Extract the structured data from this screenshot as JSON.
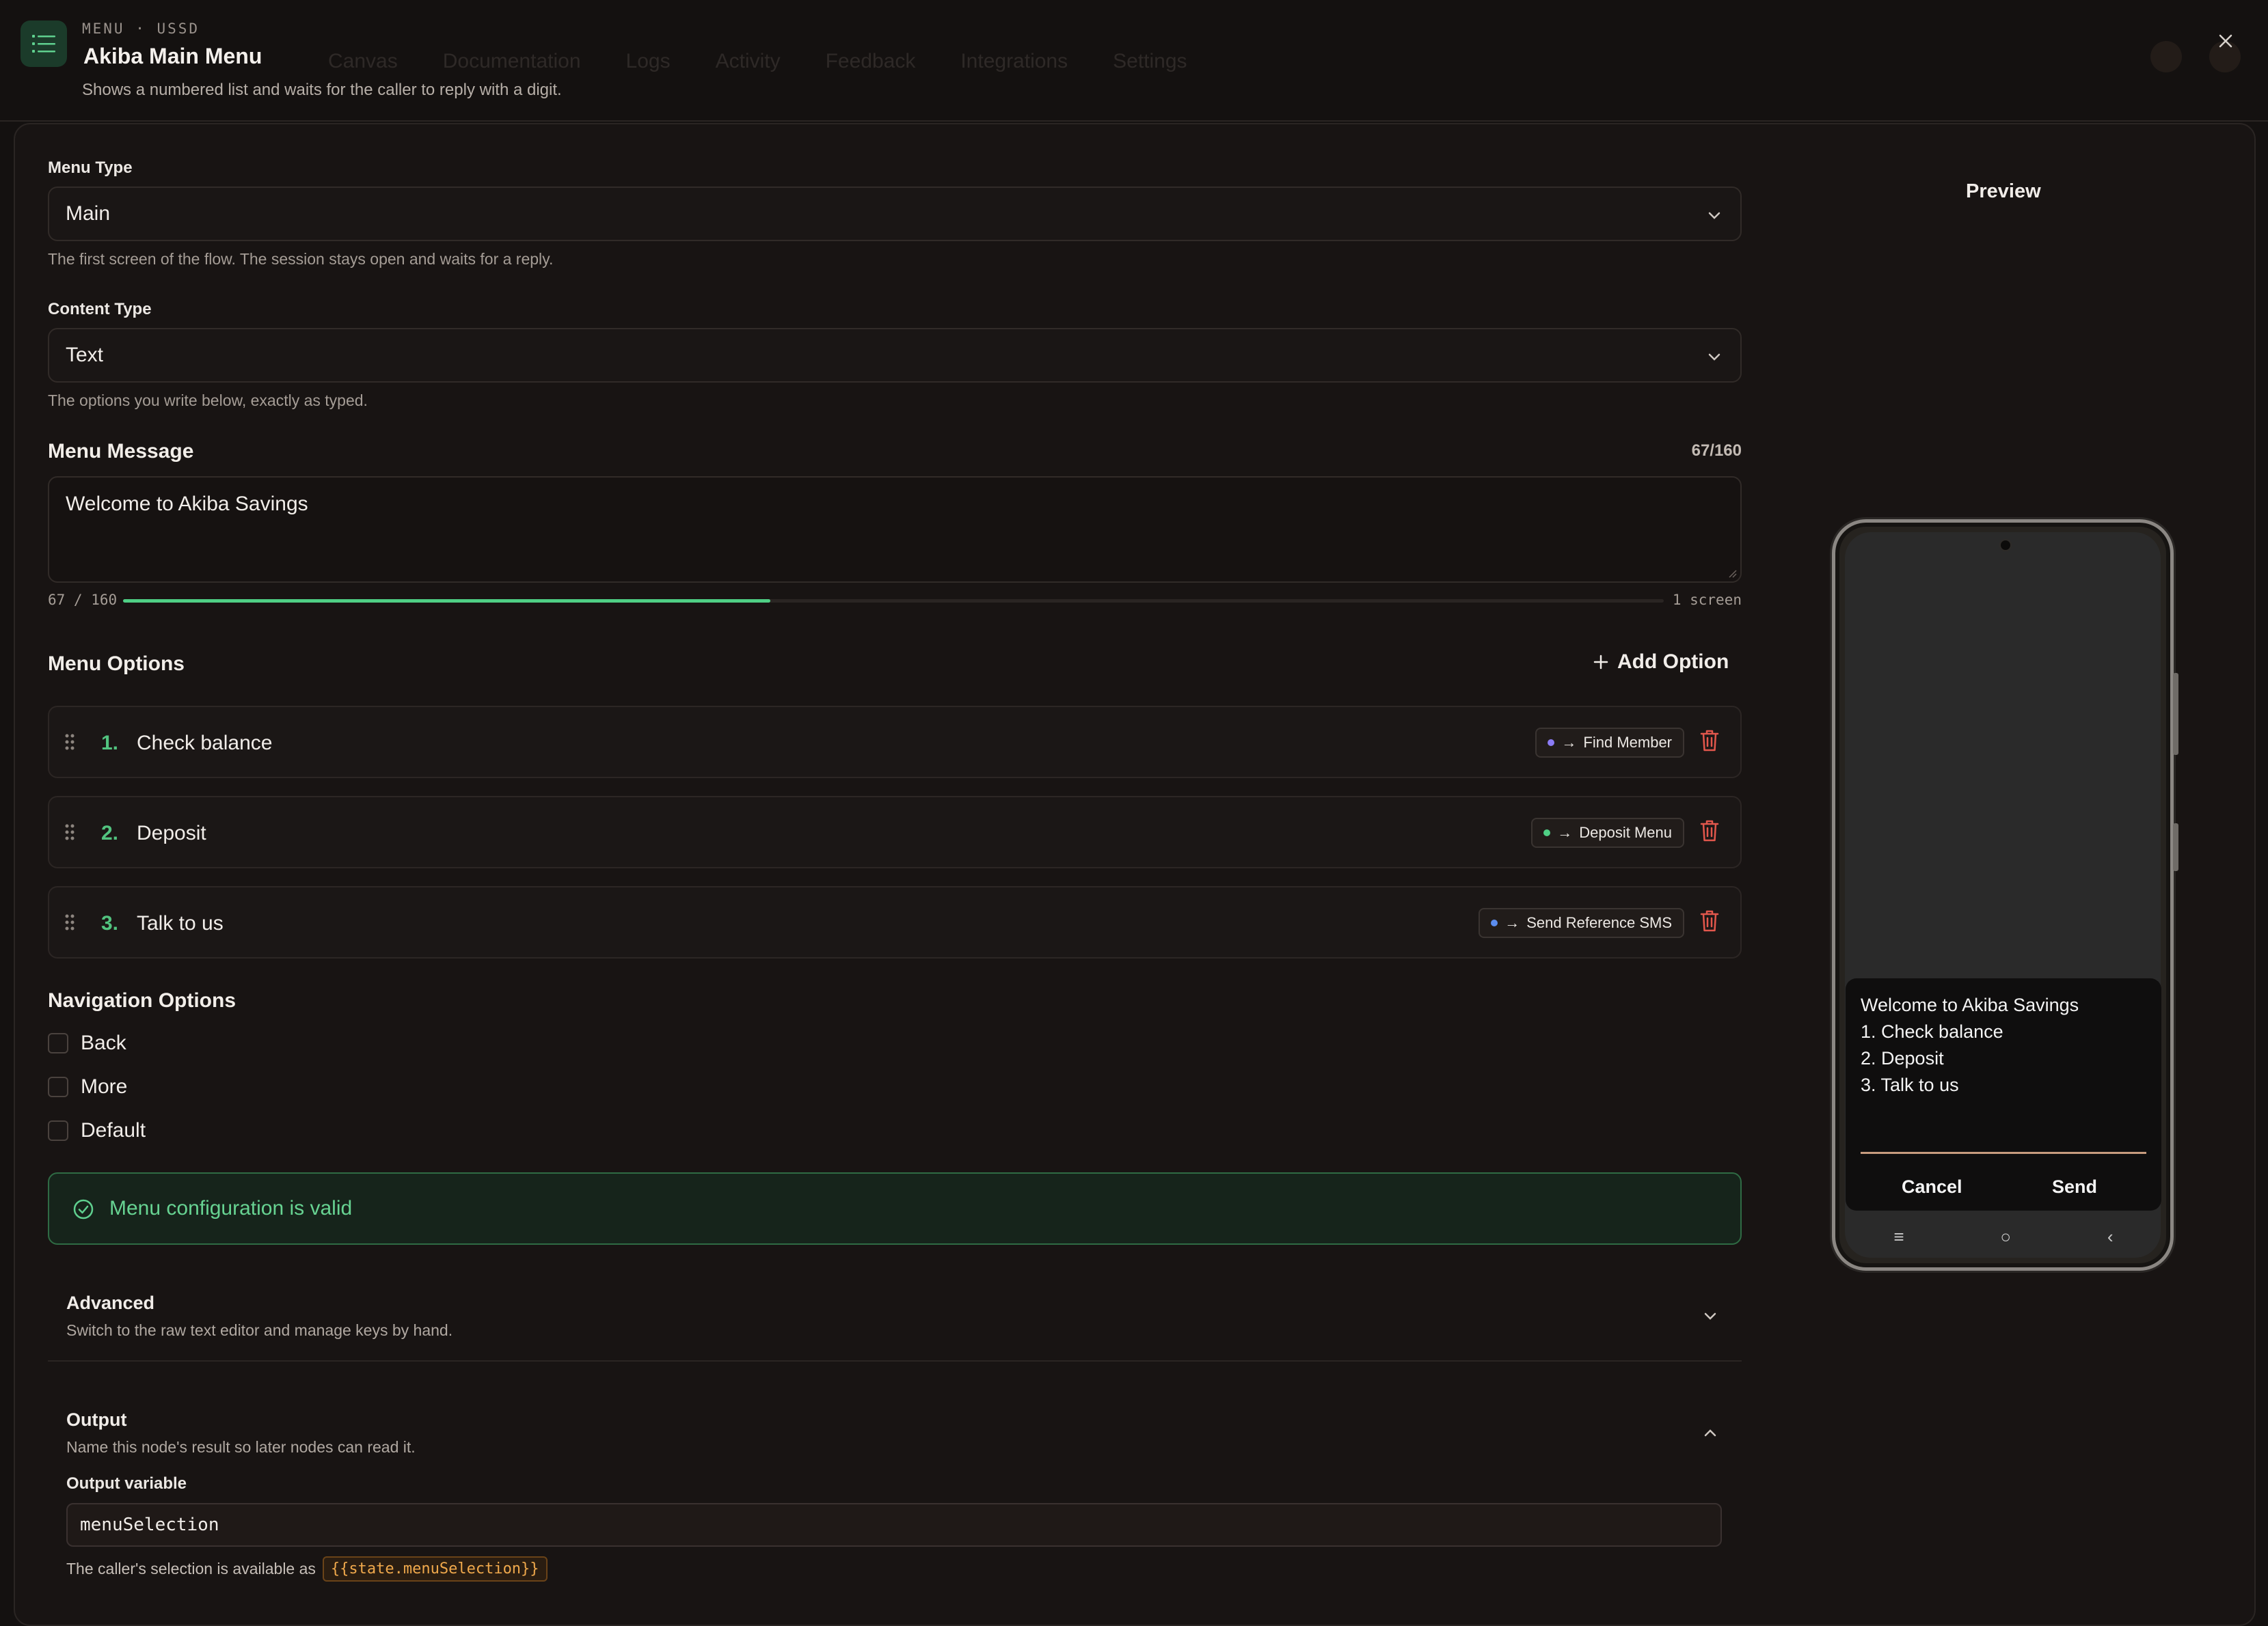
{
  "background_nav": [
    "Canvas",
    "Documentation",
    "Logs",
    "Activity",
    "Feedback",
    "Integrations",
    "Settings"
  ],
  "header": {
    "eyebrow": "MENU · USSD",
    "title": "Akiba Main Menu",
    "subtitle": "Shows a numbered list and waits for the caller to reply with a digit."
  },
  "form": {
    "menu_type": {
      "label": "Menu Type",
      "value": "Main",
      "help": "The first screen of the flow. The session stays open and waits for a reply."
    },
    "content_type": {
      "label": "Content Type",
      "value": "Text",
      "help": "The options you write below, exactly as typed."
    },
    "menu_message": {
      "label": "Menu Message",
      "char_count": "67/160",
      "value": "Welcome to Akiba Savings",
      "progress_left": "67 / 160",
      "progress_right": "1 screen",
      "progress_fraction": 0.42
    },
    "menu_options": {
      "label": "Menu Options",
      "add_label": "Add Option",
      "items": [
        {
          "num": "1.",
          "text": "Check balance",
          "target": "Find Member",
          "dot_color": "#8b7cf6"
        },
        {
          "num": "2.",
          "text": "Deposit",
          "target": "Deposit Menu",
          "dot_color": "#4fcf85"
        },
        {
          "num": "3.",
          "text": "Talk to us",
          "target": "Send Reference SMS",
          "dot_color": "#5b8def"
        }
      ]
    },
    "navigation": {
      "label": "Navigation Options",
      "items": [
        "Back",
        "More",
        "Default"
      ]
    },
    "validation": "Menu configuration is valid",
    "advanced": {
      "title": "Advanced",
      "subtitle": "Switch to the raw text editor and manage keys by hand."
    },
    "output": {
      "title": "Output",
      "subtitle": "Name this node's result so later nodes can read it.",
      "var_label": "Output variable",
      "var_value": "menuSelection",
      "avail_text": "The caller's selection is available as",
      "avail_code": "{{state.menuSelection}}"
    }
  },
  "preview": {
    "title": "Preview",
    "lines": [
      "Welcome to Akiba Savings",
      "1. Check balance",
      "2. Deposit",
      "3. Talk to us"
    ],
    "cancel": "Cancel",
    "send": "Send",
    "nav_icons": [
      "≡",
      "○",
      "‹"
    ]
  },
  "colors": {
    "accent_green": "#4fcf85",
    "danger": "#e2574c",
    "code_orange": "#f0a94c"
  }
}
